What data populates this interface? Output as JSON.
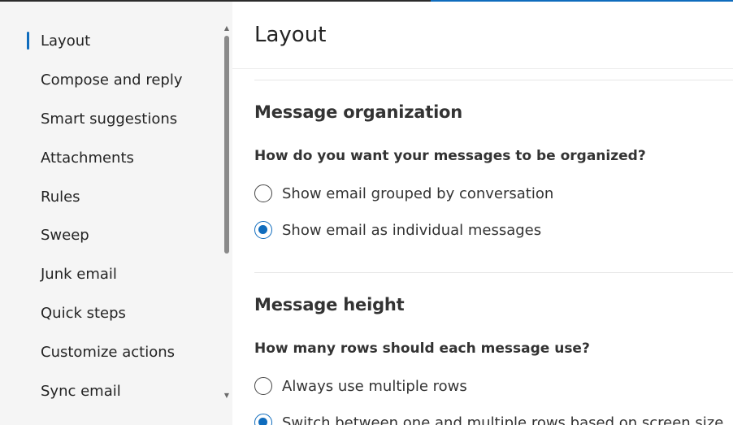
{
  "sidebar": {
    "items": [
      {
        "label": "Layout",
        "selected": true
      },
      {
        "label": "Compose and reply",
        "selected": false
      },
      {
        "label": "Smart suggestions",
        "selected": false
      },
      {
        "label": "Attachments",
        "selected": false
      },
      {
        "label": "Rules",
        "selected": false
      },
      {
        "label": "Sweep",
        "selected": false
      },
      {
        "label": "Junk email",
        "selected": false
      },
      {
        "label": "Quick steps",
        "selected": false
      },
      {
        "label": "Customize actions",
        "selected": false
      },
      {
        "label": "Sync email",
        "selected": false
      }
    ]
  },
  "main": {
    "title": "Layout",
    "sections": [
      {
        "title": "Message organization",
        "question": "How do you want your messages to be organized?",
        "options": [
          {
            "label": "Show email grouped by conversation",
            "checked": false
          },
          {
            "label": "Show email as individual messages",
            "checked": true
          }
        ]
      },
      {
        "title": "Message height",
        "question": "How many rows should each message use?",
        "options": [
          {
            "label": "Always use multiple rows",
            "checked": false
          },
          {
            "label": "Switch between one and multiple rows based on screen size",
            "checked": true
          }
        ]
      }
    ]
  },
  "colors": {
    "accent": "#0f6cbd",
    "sidebar_bg": "#f5f5f5"
  }
}
